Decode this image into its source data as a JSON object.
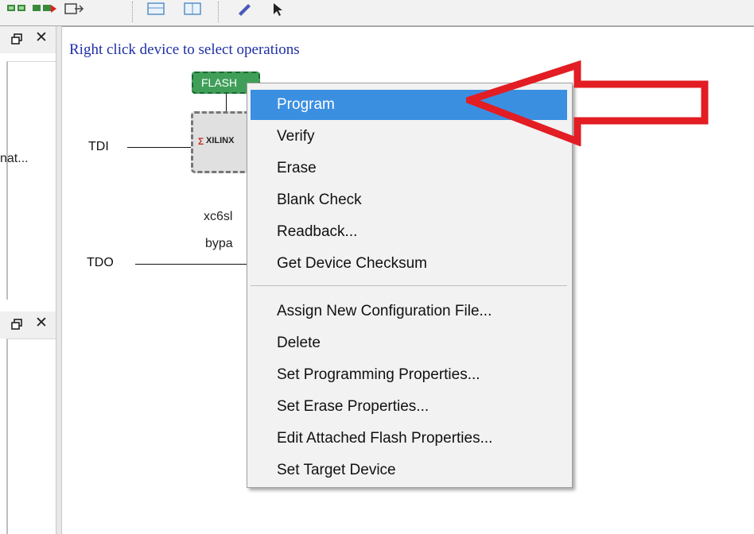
{
  "window": {
    "toolbar_icons": [
      "chain-add-icon",
      "chain-remove-icon",
      "export-icon",
      "layout-icon",
      "split-icon",
      "edit-icon",
      "pointer-icon"
    ]
  },
  "left_panels": {
    "top_panel": {
      "visible_text": "nat..."
    },
    "bottom_panel": {}
  },
  "canvas": {
    "instructions": "Right click device to select operations",
    "tdi_label": "TDI",
    "tdo_label": "TDO",
    "flash_label": "FLASH",
    "fpga_vendor": "XILINX",
    "device_name": "xc6sl",
    "device_mode": "bypa"
  },
  "context_menu": {
    "selected": "Program",
    "groups": [
      [
        "Program",
        "Verify",
        "Erase",
        "Blank Check",
        "Readback...",
        "Get Device Checksum"
      ],
      [
        "Assign New Configuration File...",
        "Delete",
        "Set Programming Properties...",
        "Set Erase Properties...",
        "Edit Attached Flash Properties...",
        "Set Target Device"
      ]
    ]
  },
  "colors": {
    "selection": "#3b8fe0",
    "annotation_arrow": "#e21d23",
    "flash_chip": "#3f9f59",
    "instructions_text": "#1f2fa5"
  }
}
